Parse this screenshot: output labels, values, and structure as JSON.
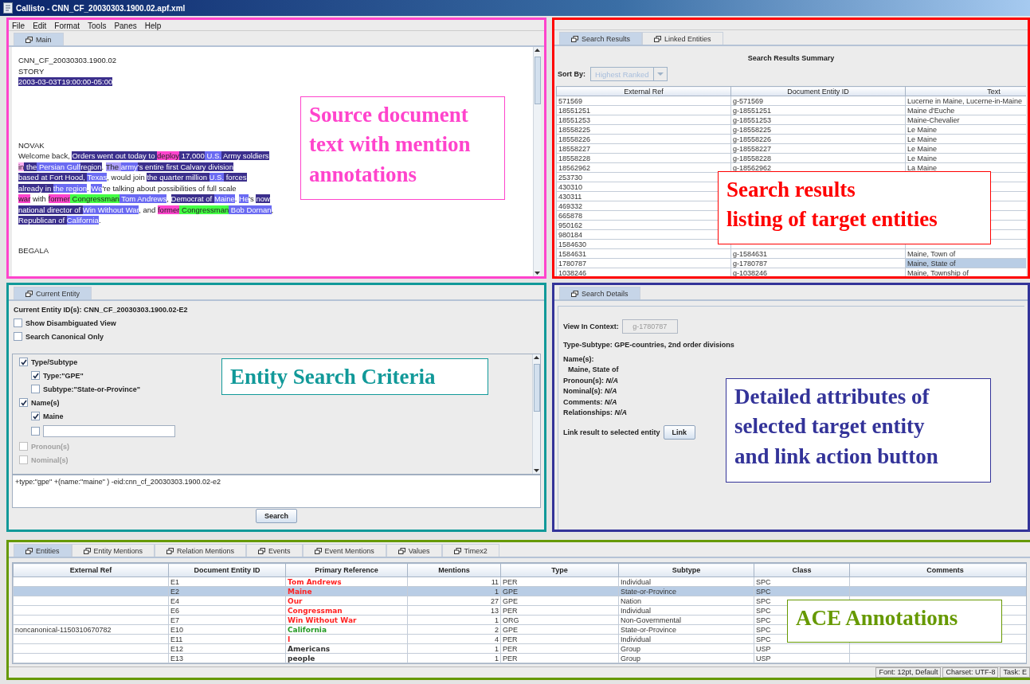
{
  "window": {
    "title": "Callisto - CNN_CF_20030303.1900.02.apf.xml"
  },
  "menu": [
    "File",
    "Edit",
    "Format",
    "Tools",
    "Panes",
    "Help"
  ],
  "document_pane": {
    "tabs": [
      {
        "label": "Main",
        "selected": true
      }
    ],
    "blocks": [
      [
        [
          {
            "text": "CNN_CF_20030303.1900.02"
          }
        ],
        [
          {
            "text": "STORY"
          }
        ],
        [
          {
            "text": "2003-03-03T19:00:00-05:00",
            "color": "#3b2f8c"
          }
        ]
      ],
      [
        [
          {
            "text": "NOVAK"
          }
        ],
        [
          {
            "text": "Welcome back, "
          },
          {
            "text": "Orders went out today to ",
            "color": "#3b2f8c"
          },
          {
            "text": "deploy",
            "color": "#ff44cc"
          },
          {
            "text": " 17,000",
            "color": "#3b2f8c"
          },
          {
            "text": " U.S.",
            "color": "#6a6af2"
          },
          {
            "text": " Army soldiers",
            "color": "#3b2f8c"
          }
        ],
        [
          {
            "text": "in",
            "color": "#ffb0f0"
          },
          {
            "text": " the",
            "color": "#3b2f8c"
          },
          {
            "text": " Persian Gulf",
            "color": "#6a6af2"
          },
          {
            "text": "region",
            "color": "#3b2f8c"
          },
          {
            "text": ". "
          },
          {
            "text": "The ",
            "color": "#a99cf7"
          },
          {
            "text": "army",
            "color": "#6a6af2"
          },
          {
            "text": "'s entire first Calvary division",
            "color": "#3b2f8c"
          }
        ],
        [
          {
            "text": "based at Fort Hood, ",
            "color": "#3b2f8c"
          },
          {
            "text": "Texas",
            "color": "#6a6af2"
          },
          {
            "text": ", would join "
          },
          {
            "text": "the quarter million ",
            "color": "#3b2f8c"
          },
          {
            "text": "U.S.",
            "color": "#6a6af2"
          },
          {
            "text": " forces",
            "color": "#3b2f8c"
          }
        ],
        [
          {
            "text": "already in ",
            "color": "#3b2f8c"
          },
          {
            "text": "the region",
            "color": "#6a6af2"
          },
          {
            "text": ". "
          },
          {
            "text": "We",
            "color": "#6a6af2"
          },
          {
            "text": "'re talking about possibilities of full scale"
          }
        ],
        [
          {
            "text": "war",
            "color": "#ff44cc"
          },
          {
            "text": " with "
          },
          {
            "text": "former",
            "color": "#ff44cc"
          },
          {
            "text": " Congressman",
            "color": "#44ff44"
          },
          {
            "text": " Tom Andrews",
            "color": "#6a6af2"
          },
          {
            "text": ", "
          },
          {
            "text": "Democrat of ",
            "color": "#3b2f8c"
          },
          {
            "text": "Maine",
            "color": "#6a6af2"
          },
          {
            "text": ". "
          },
          {
            "text": "He",
            "color": "#6a6af2"
          },
          {
            "text": "'s "
          },
          {
            "text": "now",
            "color": "#3b2f8c"
          }
        ],
        [
          {
            "text": "national director of ",
            "color": "#3b2f8c"
          },
          {
            "text": "Win Without War",
            "color": "#6a6af2"
          },
          {
            "text": ", and "
          },
          {
            "text": "former",
            "color": "#ff44cc"
          },
          {
            "text": " Congressman",
            "color": "#44ff44"
          },
          {
            "text": " Bob Dornan",
            "color": "#6a6af2"
          },
          {
            "text": ","
          }
        ],
        [
          {
            "text": "Republican of ",
            "color": "#3b2f8c"
          },
          {
            "text": "California",
            "color": "#6a6af2"
          },
          {
            "text": "."
          }
        ]
      ],
      [
        [
          {
            "text": "BEGALA"
          }
        ]
      ]
    ]
  },
  "results_pane": {
    "tabs": [
      {
        "label": "Search Results",
        "selected": true
      },
      {
        "label": "Linked Entities",
        "selected": false
      }
    ],
    "heading": "Search Results Summary",
    "sort_label": "Sort By:",
    "sort": {
      "value": "Highest Ranked",
      "disabled": true
    },
    "columns": [
      "External Ref",
      "Document Entity ID",
      "Text"
    ],
    "rows": [
      {
        "cells": [
          "571569",
          "g-571569",
          "Lucerne in Maine, Lucerne-in-Maine"
        ],
        "selected": false
      },
      {
        "cells": [
          "18551251",
          "g-18551251",
          "Maine d'Euche"
        ],
        "selected": false
      },
      {
        "cells": [
          "18551253",
          "g-18551253",
          "Maine-Chevalier"
        ],
        "selected": false
      },
      {
        "cells": [
          "18558225",
          "g-18558225",
          "Le Maine"
        ],
        "selected": false
      },
      {
        "cells": [
          "18558226",
          "g-18558226",
          "Le Maine"
        ],
        "selected": false
      },
      {
        "cells": [
          "18558227",
          "g-18558227",
          "Le Maine"
        ],
        "selected": false
      },
      {
        "cells": [
          "18558228",
          "g-18558228",
          "Le Maine"
        ],
        "selected": false
      },
      {
        "cells": [
          "18562962",
          "g-18562962",
          "La Maine"
        ],
        "selected": false
      },
      {
        "cells": [
          "253730"
        ],
        "selected": false
      },
      {
        "cells": [
          "430310"
        ],
        "selected": false
      },
      {
        "cells": [
          "430311"
        ],
        "selected": false
      },
      {
        "cells": [
          "469332"
        ],
        "selected": false
      },
      {
        "cells": [
          "665878"
        ],
        "selected": false
      },
      {
        "cells": [
          "950162"
        ],
        "selected": false
      },
      {
        "cells": [
          "980184"
        ],
        "selected": false
      },
      {
        "cells": [
          "1584630"
        ],
        "selected": false
      },
      {
        "cells": [
          "1584631",
          "g-1584631",
          "Maine, Town of"
        ],
        "selected": false
      },
      {
        "cells": [
          "1780787",
          "g-1780787",
          "Maine, State of"
        ],
        "selected": true
      },
      {
        "cells": [
          "1038246",
          "g-1038246",
          "Maine, Township of"
        ],
        "selected": false
      }
    ]
  },
  "criteria_pane": {
    "tabs": [
      {
        "label": "Current Entity",
        "selected": true
      }
    ],
    "entity_id": "Current Entity ID(s): CNN_CF_20030303.1900.02-E2",
    "options": [
      {
        "label": "Show Disambiguated View",
        "checked": false
      },
      {
        "label": "Search Canonical Only",
        "checked": false
      }
    ],
    "tree": [
      {
        "kind": "check",
        "label": "Type/Subtype",
        "checked": true,
        "disabled": false,
        "children": [
          {
            "kind": "check",
            "label": "Type:\"GPE\"",
            "checked": true,
            "disabled": false
          },
          {
            "kind": "check",
            "label": "Subtype:\"State-or-Province\"",
            "checked": false,
            "disabled": false
          }
        ]
      },
      {
        "kind": "check",
        "label": "Name(s)",
        "checked": true,
        "disabled": false,
        "children": [
          {
            "kind": "check",
            "label": "Maine",
            "checked": true,
            "disabled": false
          },
          {
            "kind": "input",
            "checked": false,
            "disabled": false
          }
        ]
      },
      {
        "kind": "check",
        "label": "Pronoun(s)",
        "checked": false,
        "disabled": true
      },
      {
        "kind": "check",
        "label": "Nominal(s)",
        "checked": false,
        "disabled": true
      }
    ],
    "query": "+type:\"gpe\" +(name:\"maine\" ) -eid:cnn_cf_20030303.1900.02-e2",
    "button": "Search"
  },
  "details_pane": {
    "tabs": [
      {
        "label": "Search Details",
        "selected": true
      }
    ],
    "context_label": "View In Context:",
    "context": {
      "value": "g-1780787",
      "disabled": true
    },
    "type_subtype": "Type-Subtype:  GPE-countries, 2nd order divisions",
    "names_label": "Name(s):",
    "name": "Maine, State of",
    "attributes": [
      "Pronoun(s): *N/A*",
      "Nominal(s): *N/A*",
      "Comments: *N/A*",
      "Relationships: *N/A*"
    ],
    "link_label": "Link result to selected entity",
    "link_button": "Link"
  },
  "annotations_pane": {
    "tabs": [
      {
        "label": "Entities",
        "selected": true
      },
      {
        "label": "Entity Mentions",
        "selected": false
      },
      {
        "label": "Relation Mentions",
        "selected": false
      },
      {
        "label": "Events",
        "selected": false
      },
      {
        "label": "Event Mentions",
        "selected": false
      },
      {
        "label": "Values",
        "selected": false
      },
      {
        "label": "Timex2",
        "selected": false
      }
    ],
    "columns": [
      "External Ref",
      "Document Entity ID",
      "Primary Reference",
      "Mentions",
      "Type",
      "Subtype",
      "Class",
      "Comments"
    ],
    "rows": [
      {
        "id": "E1",
        "reference": "Tom Andrews",
        "color": "#ff2222",
        "mentions": "11",
        "type": "PER",
        "subtype": "Individual",
        "class": "SPC",
        "selected": false
      },
      {
        "id": "E2",
        "reference": "Maine",
        "color": "#ff2222",
        "mentions": "1",
        "type": "GPE",
        "subtype": "State-or-Province",
        "class": "SPC",
        "selected": true
      },
      {
        "id": "E4",
        "reference": "Our",
        "color": "#ff2222",
        "mentions": "27",
        "type": "GPE",
        "subtype": "Nation",
        "class": "SPC",
        "selected": false
      },
      {
        "id": "E6",
        "reference": "Congressman",
        "color": "#ff2222",
        "mentions": "13",
        "type": "PER",
        "subtype": "Individual",
        "class": "SPC",
        "selected": false
      },
      {
        "id": "E7",
        "reference": "Win Without War",
        "color": "#ff2222",
        "mentions": "1",
        "type": "ORG",
        "subtype": "Non-Governmental",
        "class": "SPC",
        "selected": false
      },
      {
        "ext_ref": "noncanonical-1150310670782",
        "id": "E10",
        "reference": "California",
        "color": "#229922",
        "mentions": "2",
        "type": "GPE",
        "subtype": "State-or-Province",
        "class": "SPC",
        "selected": false
      },
      {
        "id": "E11",
        "reference": "I",
        "color": "#ff2222",
        "mentions": "4",
        "type": "PER",
        "subtype": "Individual",
        "class": "SPC",
        "selected": false
      },
      {
        "id": "E12",
        "reference": "Americans",
        "color": "#333333",
        "mentions": "1",
        "type": "PER",
        "subtype": "Group",
        "class": "USP",
        "selected": false
      },
      {
        "id": "E13",
        "reference": "people",
        "color": "#333333",
        "mentions": "1",
        "type": "PER",
        "subtype": "Group",
        "class": "USP",
        "selected": false
      }
    ]
  },
  "status_bar": [
    "Font: 12pt, Default",
    "Charset: UTF-8",
    "Task: E"
  ],
  "callouts": [
    {
      "text": "Source document\ntext with mention\nannotations",
      "color": "#ff44cc"
    },
    {
      "text": "Search results\nlisting of target entities",
      "color": "#ff0000"
    },
    {
      "text": "Entity Search Criteria",
      "color": "#119999"
    },
    {
      "text": "Detailed attributes of\nselected target entity\nand link action button",
      "color": "#333399"
    },
    {
      "text": "ACE Annotations",
      "color": "#669900"
    }
  ]
}
